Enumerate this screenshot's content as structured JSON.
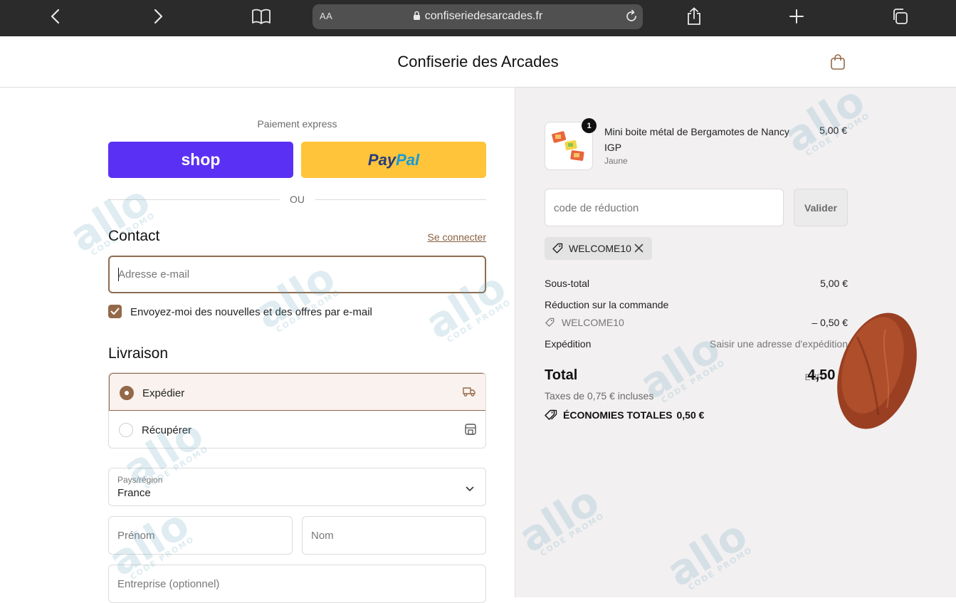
{
  "browser": {
    "text_size": "AA",
    "url": "confiseriedesarcades.fr"
  },
  "header": {
    "store_name": "Confiserie des Arcades"
  },
  "express": {
    "label": "Paiement express",
    "shop_label": "shop",
    "paypal_pay": "Pay",
    "paypal_pal": "Pal",
    "or_label": "OU"
  },
  "contact": {
    "title": "Contact",
    "login_link": "Se connecter",
    "email_placeholder": "Adresse e-mail",
    "newsletter_label": "Envoyez-moi des nouvelles et des offres par e-mail",
    "newsletter_checked": true
  },
  "delivery": {
    "title": "Livraison",
    "options": [
      {
        "label": "Expédier",
        "selected": true,
        "icon": "truck-icon"
      },
      {
        "label": "Récupérer",
        "selected": false,
        "icon": "store-icon"
      }
    ],
    "country_label": "Pays/région",
    "country_value": "France",
    "first_name_placeholder": "Prénom",
    "last_name_placeholder": "Nom",
    "company_placeholder": "Entreprise (optionnel)"
  },
  "order": {
    "item": {
      "quantity": "1",
      "name": "Mini boite métal de Bergamotes de Nancy IGP",
      "variant": "Jaune",
      "price": "5,00 €"
    },
    "discount_placeholder": "code de réduction",
    "validate_label": "Valider",
    "applied_code": "WELCOME10",
    "subtotal_label": "Sous-total",
    "subtotal_value": "5,00 €",
    "order_discount_label": "Réduction sur la commande",
    "discount_code": "WELCOME10",
    "discount_value": "– 0,50 €",
    "shipping_label": "Expédition",
    "shipping_value": "Saisir une adresse d'expédition",
    "total_label": "Total",
    "total_currency": "EUR",
    "total_value": "4,50 €",
    "taxes_note": "Taxes de 0,75 € incluses",
    "savings_label": "ÉCONOMIES TOTALES",
    "savings_value": "0,50 €"
  },
  "watermark": {
    "word": "allo",
    "sub": "CODE PROMO"
  },
  "colors": {
    "accent": "#93694a",
    "shop_purple": "#5a31f4",
    "paypal_yellow": "#ffc439"
  }
}
